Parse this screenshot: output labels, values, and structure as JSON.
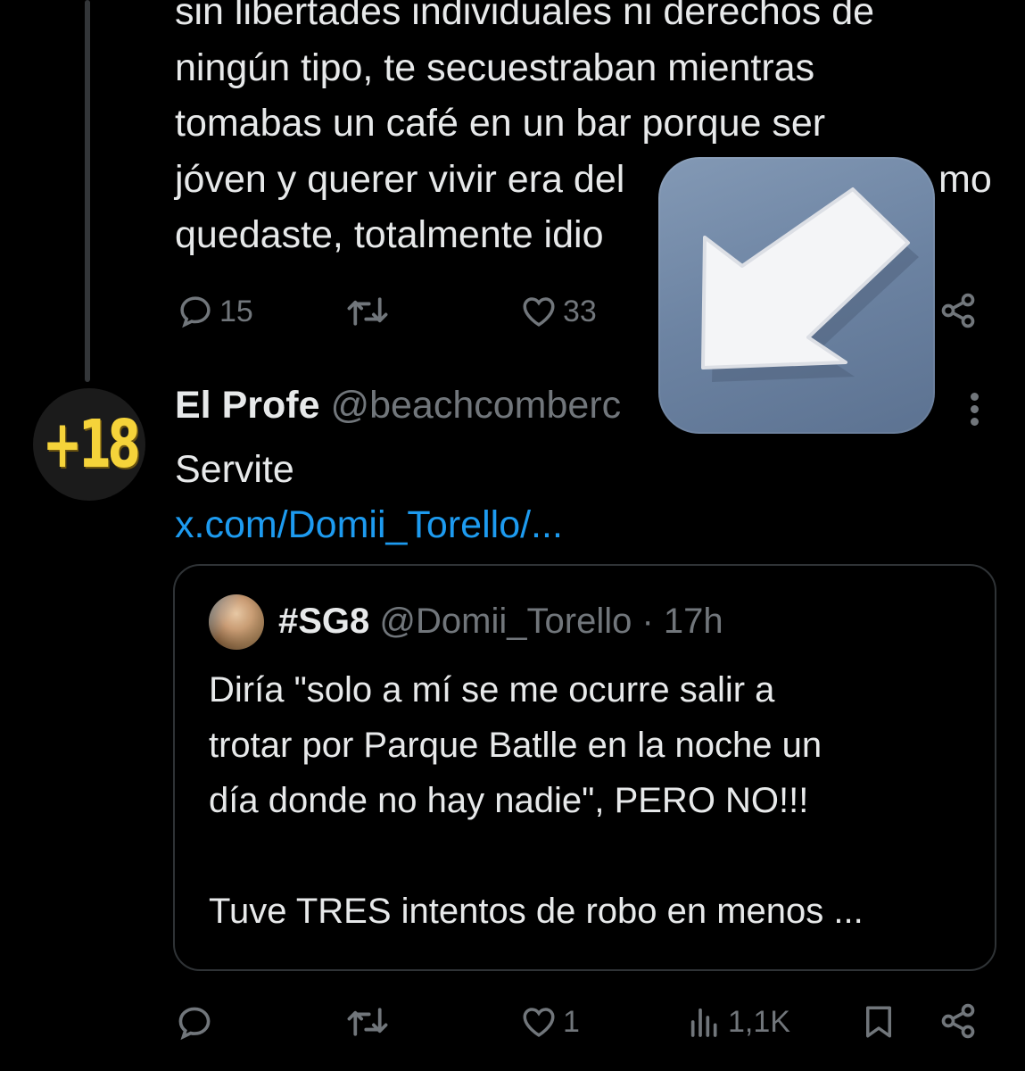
{
  "previous_post": {
    "text_lines": [
      "sin libertades individuales ni derechos de",
      "ningún tipo, te secuestraban mientras",
      "tomabas un café en un bar porque ser",
      "jóven y querer vivir  era del",
      "quedaste, totalmente idio"
    ],
    "text_line_tail": "mo",
    "replies": "15",
    "likes": "33"
  },
  "post": {
    "avatar_text": "+18",
    "name": "El Profe",
    "handle": "@beachcomberc",
    "body": "Servite",
    "link": "x.com/Domii_Torello/...",
    "likes": "1",
    "views": "1,1K"
  },
  "quote": {
    "name": "#SG8",
    "handle": "@Domii_Torello",
    "separator": "·",
    "time": "17h",
    "paragraphs": [
      "Diría \"solo a mí se me ocurre salir a",
      "trotar por Parque Batlle en la noche un",
      "día donde no hay nadie\", PERO NO!!!",
      "",
      "Tuve TRES intentos de robo en menos ..."
    ]
  },
  "icons": {
    "reply": "reply-icon",
    "retweet": "retweet-icon",
    "like": "heart-icon",
    "views": "views-icon",
    "bookmark": "bookmark-icon",
    "share": "share-icon",
    "more": "more-icon",
    "overlay": "arrow-down-left-icon"
  },
  "colors": {
    "background": "#000000",
    "text": "#e7e9ea",
    "muted": "#71767b",
    "link": "#1d9bf0",
    "avatar_badge": "#f5d33a"
  }
}
